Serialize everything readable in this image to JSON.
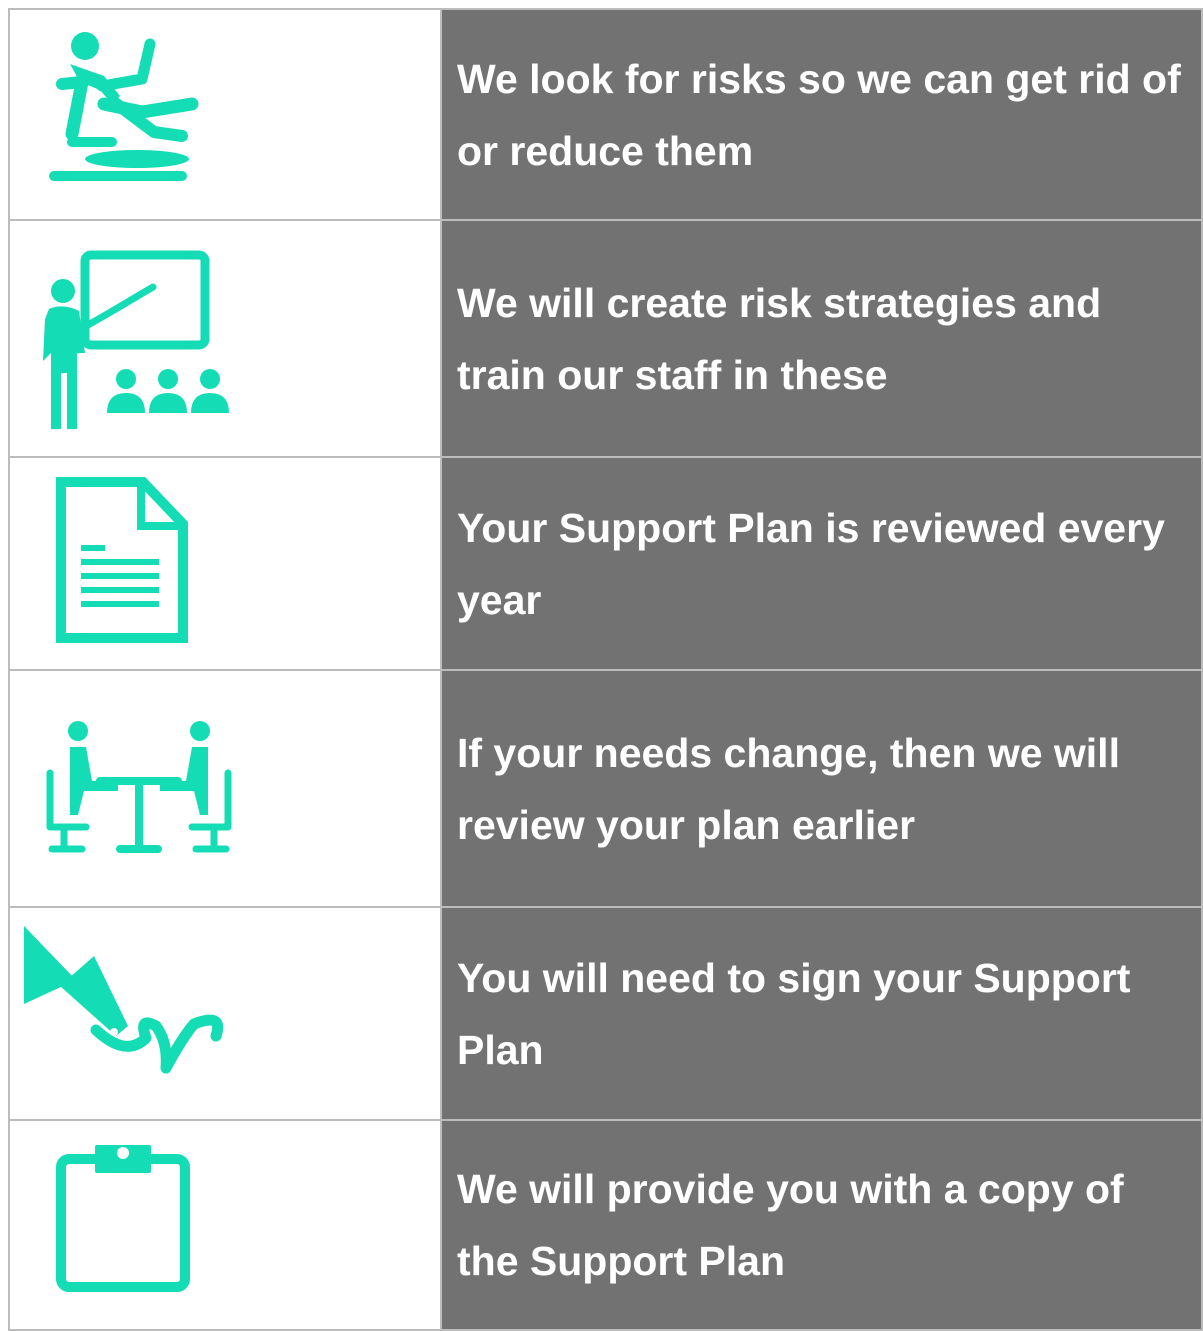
{
  "colors": {
    "accent": "#14dcb4",
    "text_bg": "#727272",
    "text": "#ffffff",
    "border": "#bcbcbc"
  },
  "rows": [
    {
      "icon": "person-slipping-icon",
      "text": "We look for risks so we can get rid of or reduce them"
    },
    {
      "icon": "teacher-training-icon",
      "text": "We will create risk strategies and train our staff in these"
    },
    {
      "icon": "document-icon",
      "text": "Your Support Plan is reviewed every year"
    },
    {
      "icon": "meeting-table-icon",
      "text": "If your needs change, then we will review your plan earlier"
    },
    {
      "icon": "fountain-pen-signature-icon",
      "text": "You will need to sign your Support Plan"
    },
    {
      "icon": "clipboard-icon",
      "text": "We will provide you with a copy of the Support Plan"
    }
  ]
}
